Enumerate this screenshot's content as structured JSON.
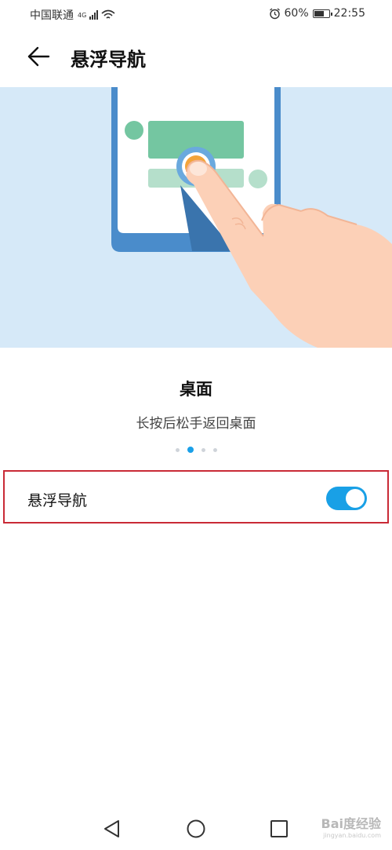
{
  "status_bar": {
    "carrier": "中国联通",
    "network": "4G",
    "battery": "60%",
    "time": "22:55",
    "icons": [
      "signal-icon",
      "wifi-icon",
      "alarm-icon",
      "battery-icon"
    ]
  },
  "header": {
    "back_icon": "back-arrow-icon",
    "title": "悬浮导航"
  },
  "gesture": {
    "title": "桌面",
    "description": "长按后松手返回桌面"
  },
  "pager": {
    "count": 4,
    "active": 1
  },
  "setting": {
    "label": "悬浮导航",
    "enabled": true
  },
  "nav_bar": {
    "icons": [
      "back-triangle-icon",
      "home-circle-icon",
      "recents-square-icon"
    ]
  },
  "watermark": {
    "text": "Bai度经验",
    "subtext": "jingyan.baidu.com"
  },
  "colors": {
    "accent": "#19a0e6",
    "illustration_bg": "#d6e9f8",
    "highlight_border": "#c92a36"
  }
}
